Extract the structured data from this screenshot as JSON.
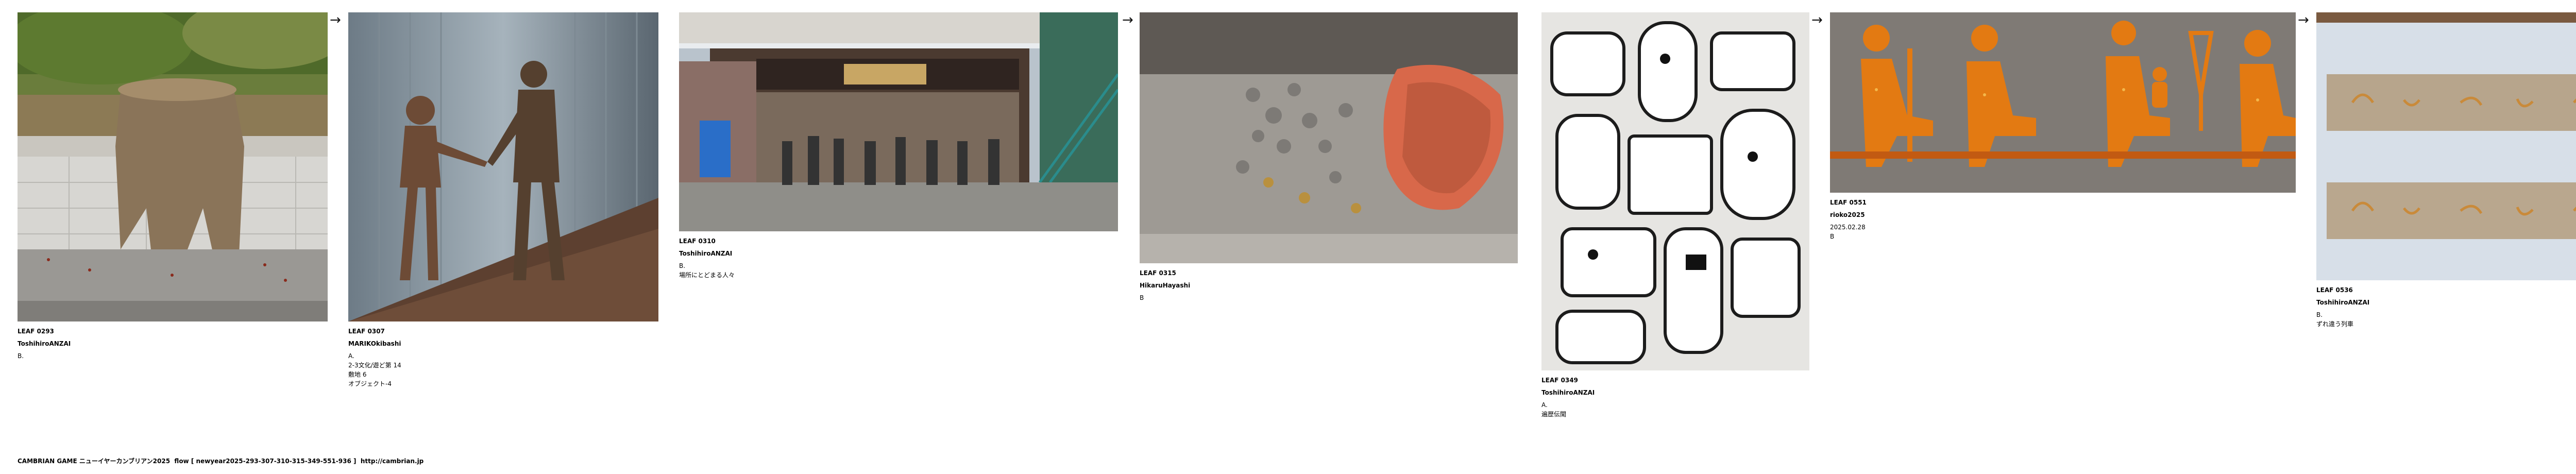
{
  "leaves": [
    {
      "code": "LEAF 0293",
      "author": "ToshihiroANZAI",
      "lines": [
        "B."
      ]
    },
    {
      "code": "LEAF 0307",
      "author": "MARIKOkibashi",
      "lines": [
        "A.",
        "2-3文化/遊ど第 14",
        "敷地 6",
        "オブジェクト-4"
      ]
    },
    {
      "code": "LEAF 0310",
      "author": "ToshihiroANZAI",
      "lines": [
        "B.",
        "場所にとどまる人々"
      ]
    },
    {
      "code": "LEAF 0315",
      "author": "HikaruHayashi",
      "lines": [
        "B"
      ]
    },
    {
      "code": "LEAF 0349",
      "author": "ToshihiroANZAI",
      "lines": [
        "A.",
        "遍歴伝聞"
      ]
    },
    {
      "code": "LEAF 0551",
      "author": "rioko2025",
      "lines": [
        "2025.02.28",
        "B"
      ]
    },
    {
      "code": "LEAF 0536",
      "author": "ToshihiroANZAI",
      "lines": [
        "B.",
        "ずれ違う列車"
      ]
    }
  ],
  "arrow_glyph": "→",
  "footer": {
    "title": "CAMBRIAN GAME ニューイヤーカンブリアン2025",
    "flow": "flow [ newyear2025-293-307-310-315-349-551-936 ]",
    "url": "http://cambrian.jp"
  },
  "colors": {
    "background": "#ffffff",
    "text": "#000000"
  }
}
